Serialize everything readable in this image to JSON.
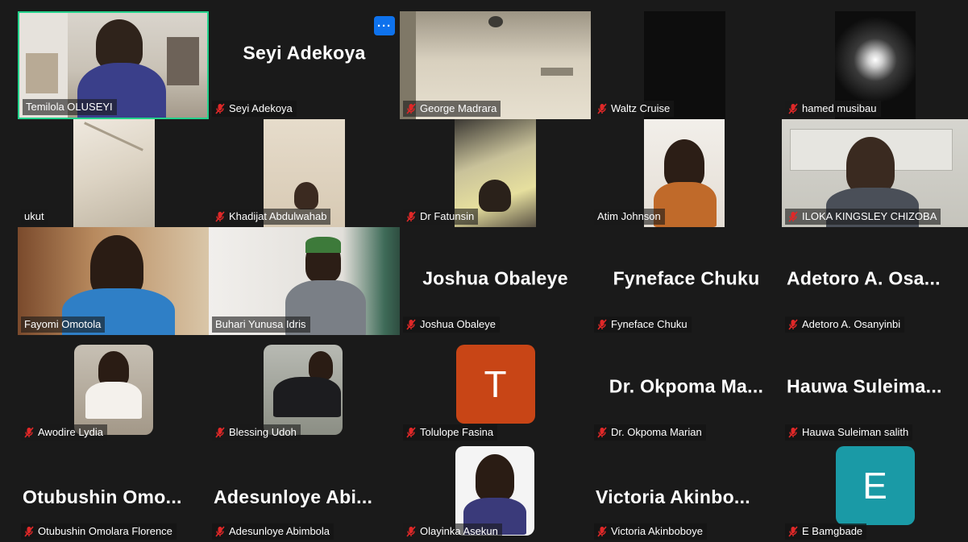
{
  "colors": {
    "background": "#1a1a1a",
    "active_speaker_border": "#23d18b",
    "more_button": "#0e72ed",
    "muted_mic": "#e02828",
    "avatar_orange": "#c84516",
    "avatar_teal": "#1a9aa6"
  },
  "more_button_icon": "ellipsis-icon",
  "muted_icon": "muted-mic-icon",
  "participants": [
    {
      "name": "Temilola OLUSEYI",
      "big_name": "",
      "muted": false,
      "video": true,
      "active": true
    },
    {
      "name": "Seyi Adekoya",
      "big_name": "Seyi Adekoya",
      "muted": true,
      "video": false,
      "active": false
    },
    {
      "name": "George Madrara",
      "big_name": "",
      "muted": true,
      "video": true,
      "active": false
    },
    {
      "name": "Waltz Cruise",
      "big_name": "",
      "muted": true,
      "video": true,
      "active": false
    },
    {
      "name": "hamed musibau",
      "big_name": "",
      "muted": true,
      "video": true,
      "active": false
    },
    {
      "name": "ukut",
      "big_name": "",
      "muted": false,
      "video": true,
      "active": false
    },
    {
      "name": "Khadijat Abdulwahab",
      "big_name": "",
      "muted": true,
      "video": true,
      "active": false
    },
    {
      "name": "Dr Fatunsin",
      "big_name": "",
      "muted": true,
      "video": true,
      "active": false
    },
    {
      "name": "Atim Johnson",
      "big_name": "",
      "muted": false,
      "video": true,
      "active": false
    },
    {
      "name": "ILOKA KINGSLEY CHIZOBA",
      "big_name": "",
      "muted": true,
      "video": true,
      "active": false
    },
    {
      "name": "Fayomi Omotola",
      "big_name": "",
      "muted": false,
      "video": true,
      "active": false
    },
    {
      "name": "Buhari Yunusa Idris",
      "big_name": "",
      "muted": false,
      "video": true,
      "active": false
    },
    {
      "name": "Joshua Obaleye",
      "big_name": "Joshua Obaleye",
      "muted": true,
      "video": false,
      "active": false
    },
    {
      "name": "Fyneface Chuku",
      "big_name": "Fyneface Chuku",
      "muted": true,
      "video": false,
      "active": false
    },
    {
      "name": "Adetoro A. Osanyinbi",
      "big_name": "Adetoro A. Osa...",
      "muted": true,
      "video": false,
      "active": false
    },
    {
      "name": "Awodire Lydia",
      "big_name": "",
      "muted": true,
      "video": true,
      "active": false
    },
    {
      "name": "Blessing Udoh",
      "big_name": "",
      "muted": true,
      "video": true,
      "active": false
    },
    {
      "name": "Tolulope Fasina",
      "big_name": "",
      "avatar_letter": "T",
      "muted": true,
      "video": false,
      "active": false
    },
    {
      "name": "Dr. Okpoma Marian",
      "big_name": "Dr. Okpoma Ma...",
      "muted": true,
      "video": false,
      "active": false
    },
    {
      "name": "Hauwa Suleiman salith",
      "big_name": "Hauwa Suleima...",
      "muted": true,
      "video": false,
      "active": false
    },
    {
      "name": "Otubushin Omolara Florence",
      "big_name": "Otubushin Omo...",
      "muted": true,
      "video": false,
      "active": false
    },
    {
      "name": "Adesunloye Abimbola",
      "big_name": "Adesunloye Abi...",
      "muted": true,
      "video": false,
      "active": false
    },
    {
      "name": "Olayinka Asekun",
      "big_name": "",
      "muted": true,
      "video": true,
      "active": false
    },
    {
      "name": "Victoria Akinboboye",
      "big_name": "Victoria Akinbo...",
      "muted": true,
      "video": false,
      "active": false
    },
    {
      "name": "E Bamgbade",
      "big_name": "",
      "avatar_letter": "E",
      "muted": true,
      "video": false,
      "active": false
    }
  ]
}
